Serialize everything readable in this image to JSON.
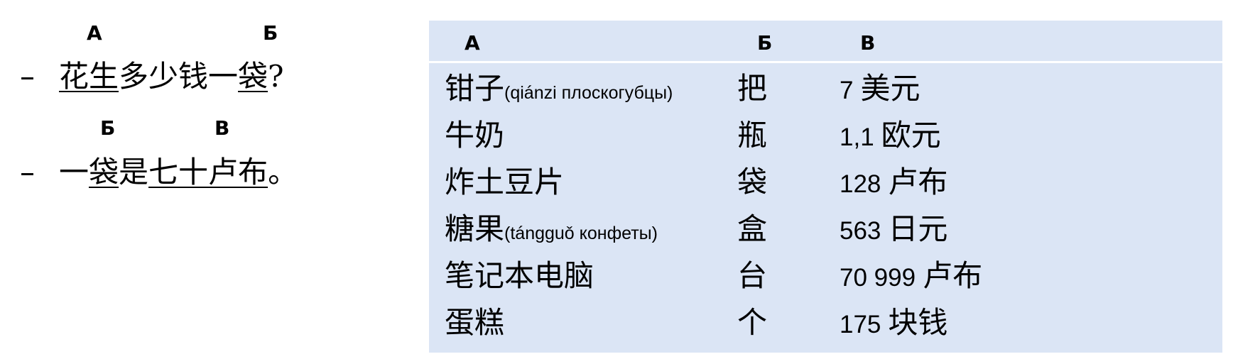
{
  "dialogue": {
    "markers": [
      "А",
      "Б",
      "Б",
      "В"
    ],
    "line1": {
      "dash": "–",
      "a": "花生",
      "mid": "多少钱一",
      "b": "袋",
      "end": "?"
    },
    "line2": {
      "dash": "–",
      "pre": "一",
      "b": "袋",
      "mid": "是",
      "c": "七十卢布",
      "end": "。"
    }
  },
  "table": {
    "headers": [
      "А",
      "Б",
      "В"
    ],
    "rows": [
      {
        "a": "钳子",
        "a_note": "(qiánzi плоскогубцы)",
        "b": "把",
        "c_num": "7",
        "c_unit": "美元"
      },
      {
        "a": "牛奶",
        "a_note": "",
        "b": "瓶",
        "c_num": "1,1",
        "c_unit": "欧元"
      },
      {
        "a": "炸土豆片",
        "a_note": "",
        "b": "袋",
        "c_num": "128",
        "c_unit": "卢布"
      },
      {
        "a": "糖果",
        "a_note": "(tángguǒ конфеты)",
        "b": "盒",
        "c_num": "563",
        "c_unit": "日元"
      },
      {
        "a": "笔记本电脑",
        "a_note": "",
        "b": "台",
        "c_num": "70 999",
        "c_unit": "卢布"
      },
      {
        "a": "蛋糕",
        "a_note": "",
        "b": "个",
        "c_num": "175",
        "c_unit": "块钱"
      }
    ]
  },
  "colors": {
    "table_background": "#dbe5f5",
    "header_divider": "#ffffff",
    "text": "#000000"
  }
}
